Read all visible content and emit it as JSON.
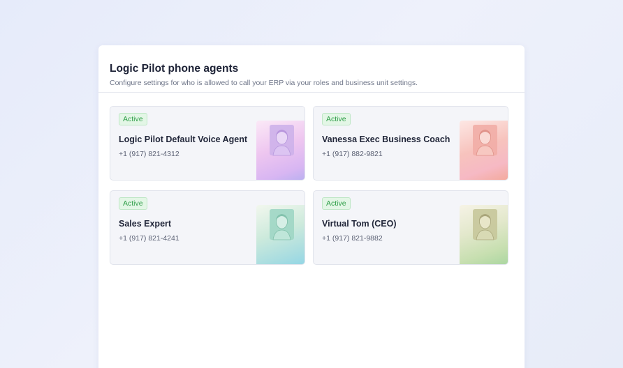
{
  "panel": {
    "title": "Logic Pilot phone agents",
    "subtitle": "Configure settings for who is allowed to call your ERP via your roles and business unit settings."
  },
  "agents": [
    {
      "status": "Active",
      "name": "Logic Pilot Default Voice Agent",
      "phone": "+1 (917) 821-4312",
      "portrait_color": "#d2b3ee",
      "icon": "agent-portrait-icon"
    },
    {
      "status": "Active",
      "name": "Vanessa Exec Business Coach",
      "phone": "+1 (917) 882-9821",
      "portrait_color": "#f2b2a8",
      "icon": "agent-portrait-icon"
    },
    {
      "status": "Active",
      "name": "Sales Expert",
      "phone": "+1 (917) 821-4241",
      "portrait_color": "#a4d9d2",
      "icon": "agent-portrait-icon"
    },
    {
      "status": "Active",
      "name": "Virtual Tom (CEO)",
      "phone": "+1 (917) 821-9882",
      "portrait_color": "#c9d8a6",
      "icon": "agent-portrait-icon"
    }
  ],
  "colors": {
    "active_text": "#2f9e48",
    "active_bg": "#e3f6e6",
    "title_text": "#1d2236",
    "card_bg": "#f4f5f9"
  }
}
